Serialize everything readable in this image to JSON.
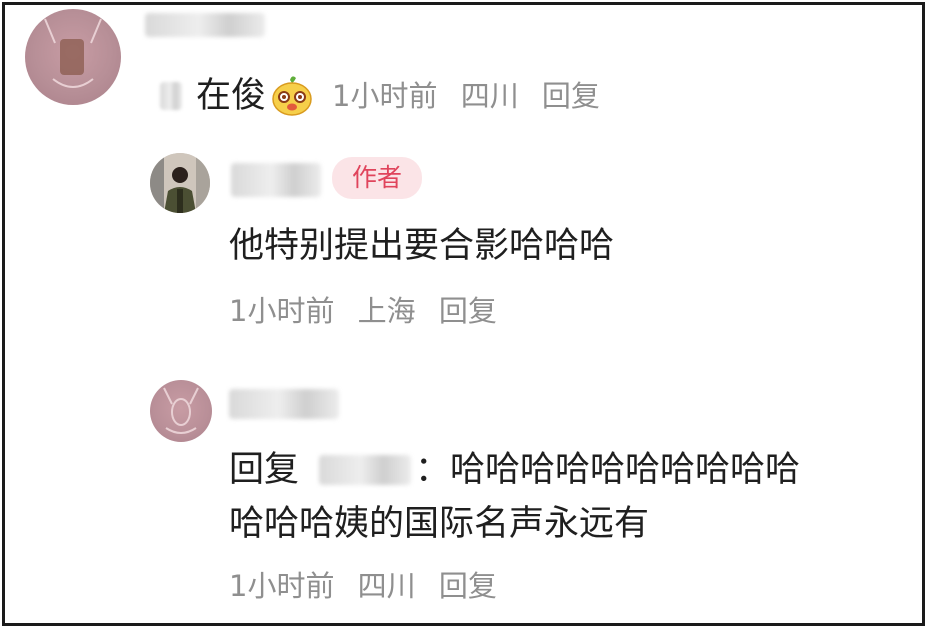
{
  "comments": [
    {
      "username": "在俊",
      "time": "1小时前",
      "location": "四川",
      "reply_label": "回复",
      "emoji": "cartoon-face-icon"
    },
    {
      "author_badge": "作者",
      "text": "他特别提出要合影哈哈哈",
      "time": "1小时前",
      "location": "上海",
      "reply_label": "回复"
    },
    {
      "reply_prefix": "回复",
      "colon": "：",
      "text_line1": "哈哈哈哈哈哈哈哈哈哈",
      "text_line2": "哈哈哈姨的国际名声永远有",
      "time": "1小时前",
      "location": "四川",
      "reply_label": "回复"
    }
  ],
  "colors": {
    "badge_bg": "#fbe4e7",
    "badge_text": "#e0445c",
    "meta_text": "#8f8f8f",
    "body_text": "#1f1f1f"
  }
}
